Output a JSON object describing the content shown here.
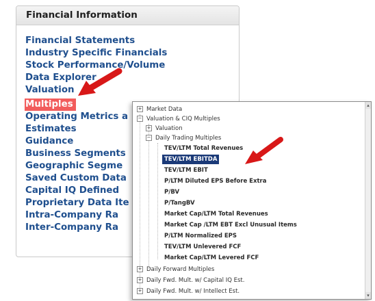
{
  "financial_panel": {
    "title": "Financial Information",
    "items": [
      {
        "label": "Financial Statements"
      },
      {
        "label": "Industry Specific Financials"
      },
      {
        "label": "Stock Performance/Volume"
      },
      {
        "label": "Data Explorer"
      },
      {
        "label": "Valuation"
      },
      {
        "label": "Multiples"
      },
      {
        "label": "Operating Metrics a"
      },
      {
        "label": "Estimates"
      },
      {
        "label": "Guidance"
      },
      {
        "label": "Business Segments"
      },
      {
        "label": "Geographic Segme"
      },
      {
        "label": "Saved Custom Data"
      },
      {
        "label": "Capital IQ Defined"
      },
      {
        "label": "Proprietary Data Ite"
      },
      {
        "label": "Intra-Company Ra"
      },
      {
        "label": "Inter-Company Ra"
      }
    ]
  },
  "tree_panel": {
    "nodes": [
      {
        "label": "Market Data",
        "expander": "+"
      },
      {
        "label": "Valuation & CIQ Multiples",
        "expander": "−"
      },
      {
        "label": "Valuation",
        "expander": "+"
      },
      {
        "label": "Daily Trading Multiples",
        "expander": "−"
      },
      {
        "label": "TEV/LTM Total Revenues"
      },
      {
        "label": "TEV/LTM EBITDA"
      },
      {
        "label": "TEV/LTM EBIT"
      },
      {
        "label": "P/LTM Diluted EPS Before Extra"
      },
      {
        "label": "P/BV"
      },
      {
        "label": "P/TangBV"
      },
      {
        "label": "Market Cap/LTM Total Revenues"
      },
      {
        "label": "Market Cap /LTM EBT Excl Unusual Items"
      },
      {
        "label": "P/LTM Normalized EPS"
      },
      {
        "label": "TEV/LTM Unlevered FCF"
      },
      {
        "label": "Market Cap/LTM Levered FCF"
      },
      {
        "label": "Daily Forward Multiples",
        "expander": "+"
      },
      {
        "label": "Daily Fwd. Mult. w/ Capital IQ Est.",
        "expander": "+"
      },
      {
        "label": "Daily Fwd. Mult. w/ Intellect Est.",
        "expander": "+"
      }
    ]
  },
  "colors": {
    "link_blue": "#1f4f8e",
    "selected_red": "#f25c5c",
    "tree_highlight": "#1b3a78",
    "arrow_red": "#d81818"
  },
  "icons": [
    "red-arrow-pointer",
    "scroll-up-arrow",
    "scroll-down-arrow"
  ]
}
